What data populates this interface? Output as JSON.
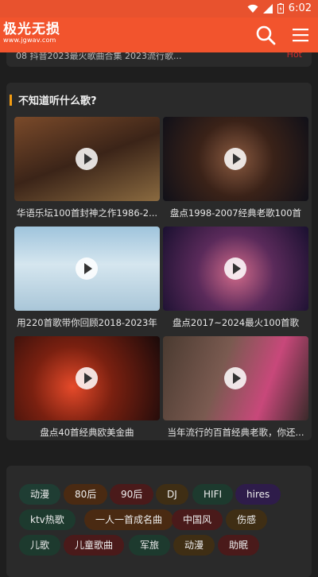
{
  "status": {
    "time": "6:02"
  },
  "app": {
    "logo_title": "极光无损",
    "logo_url": "www.jgwav.com"
  },
  "previous_item": {
    "number": "08",
    "title": "抖音2023最火歌曲合集 2023流行歌...",
    "badge": "Hot"
  },
  "recommend": {
    "section_title": "不知道听什么歌?",
    "tiles": [
      {
        "caption": "华语乐坛100首封神之作1986-2..."
      },
      {
        "caption": "盘点1998-2007经典老歌100首"
      },
      {
        "caption": "用220首歌带你回顾2018-2023年"
      },
      {
        "caption": "盘点2017~2024最火100首歌"
      },
      {
        "caption": "盘点40首经典欧美金曲"
      },
      {
        "caption": "当年流行的百首经典老歌，你还..."
      }
    ]
  },
  "tags": [
    {
      "label": "动漫",
      "color": "c-green"
    },
    {
      "label": "80后",
      "color": "c-brown"
    },
    {
      "label": "90后",
      "color": "c-red"
    },
    {
      "label": "DJ",
      "color": "c-olive"
    },
    {
      "label": "HIFI",
      "color": "c-dkgreen"
    },
    {
      "label": "hires",
      "color": "c-purple"
    },
    {
      "label": "ktv热歌",
      "color": "c-dkgreen"
    },
    {
      "label": "一人一首成名曲",
      "color": "c-brown"
    },
    {
      "label": "中国风",
      "color": "c-red"
    },
    {
      "label": "伤感",
      "color": "c-olive"
    },
    {
      "label": "儿歌",
      "color": "c-dkgreen"
    },
    {
      "label": "儿童歌曲",
      "color": "c-red"
    },
    {
      "label": "军旅",
      "color": "c-dkgreen"
    },
    {
      "label": "动漫",
      "color": "c-olive"
    },
    {
      "label": "助眠",
      "color": "c-red"
    }
  ],
  "icons": {
    "search": "search-icon",
    "menu": "menu-icon",
    "wifi": "wifi-icon",
    "signal": "signal-icon",
    "battery": "battery-icon"
  }
}
